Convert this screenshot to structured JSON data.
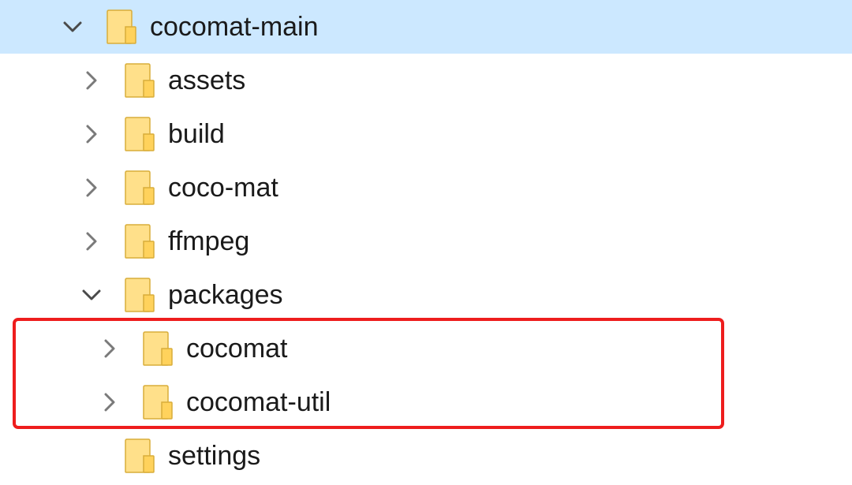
{
  "tree": {
    "root": {
      "label": "cocomat-main",
      "expanded": true,
      "selected": true,
      "icon": "folder-icon",
      "expander": "chevron-down-icon"
    },
    "children": [
      {
        "label": "assets",
        "expanded": false,
        "icon": "folder-icon",
        "expander": "chevron-right-icon"
      },
      {
        "label": "build",
        "expanded": false,
        "icon": "folder-icon",
        "expander": "chevron-right-icon"
      },
      {
        "label": "coco-mat",
        "expanded": false,
        "icon": "folder-icon",
        "expander": "chevron-right-icon"
      },
      {
        "label": "ffmpeg",
        "expanded": false,
        "icon": "folder-icon",
        "expander": "chevron-right-icon"
      },
      {
        "label": "packages",
        "expanded": true,
        "icon": "folder-icon",
        "expander": "chevron-down-icon",
        "children": [
          {
            "label": "cocomat",
            "expanded": false,
            "icon": "folder-icon",
            "expander": "chevron-right-icon"
          },
          {
            "label": "cocomat-util",
            "expanded": false,
            "icon": "folder-icon",
            "expander": "chevron-right-icon"
          }
        ]
      },
      {
        "label": "settings",
        "expanded": false,
        "icon": "folder-icon",
        "expander": null
      }
    ]
  },
  "annotation": {
    "color": "#ee1d1d",
    "shape": "rounded-rectangle",
    "encloses": [
      "cocomat",
      "cocomat-util"
    ]
  },
  "colors": {
    "selection": "#cce8ff",
    "folder": "#ffe08a",
    "chevron": "#7a7a7a"
  }
}
